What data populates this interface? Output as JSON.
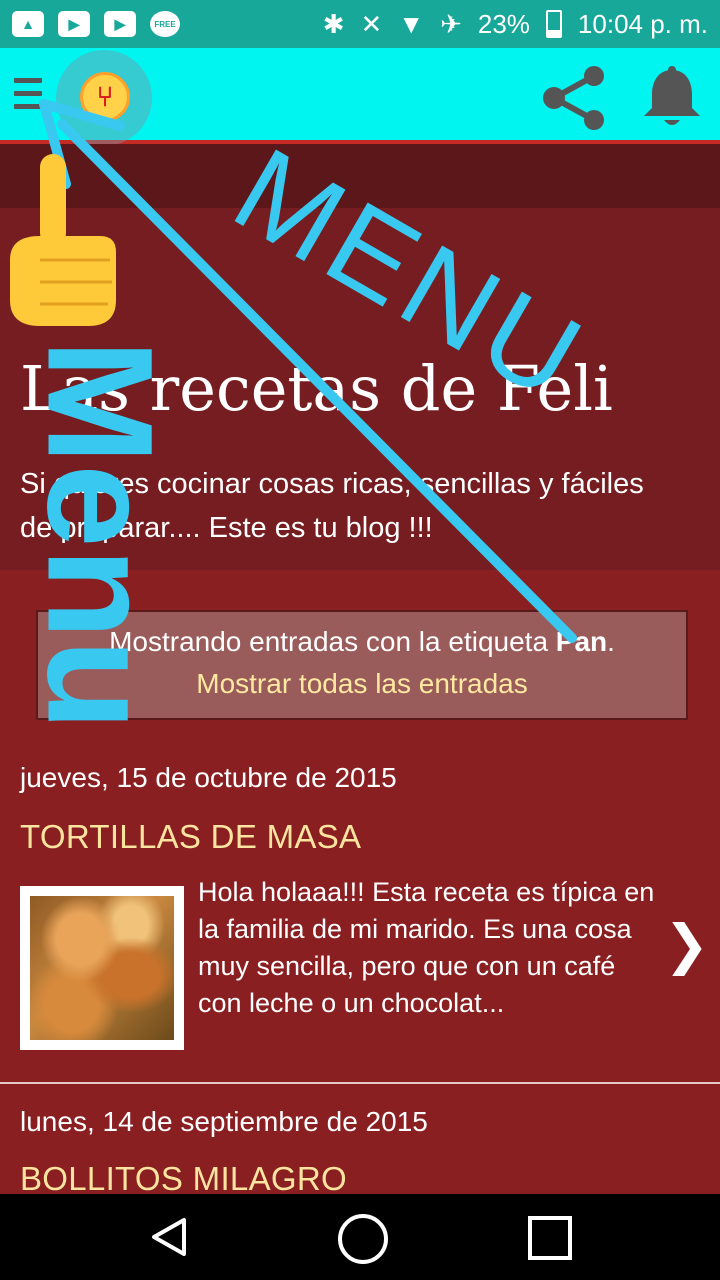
{
  "status_bar": {
    "battery": "23%",
    "time": "10:04 p. m.",
    "free_badge": "FREE"
  },
  "header": {
    "title": "Las recetas de Feli",
    "description": "Si quieres cocinar cosas ricas, sencillas y fáciles de preparar.... Este es tu blog !!!"
  },
  "filter": {
    "prefix": "Mostrando entradas con la etiqueta ",
    "label": "Pan",
    "suffix": ".",
    "show_all": "Mostrar todas las entradas"
  },
  "posts": [
    {
      "date": "jueves, 15 de octubre de 2015",
      "title": "TORTILLAS DE MASA",
      "snippet": "Hola holaaa!!! Esta receta es típica en la familia de mi marido. Es una cosa muy sencilla, pero que con un café con leche o un chocolat..."
    },
    {
      "date": "lunes, 14 de septiembre de 2015",
      "title": "BOLLITOS MILAGRO"
    }
  ],
  "annotations": {
    "menu_big": "MENU",
    "menu_vertical": "Menu"
  },
  "colors": {
    "status_bar": "#17a89a",
    "app_bar": "#00f5f1",
    "page_bg": "#8a1f22",
    "annotation": "#38c8f0",
    "post_title": "#fbe4a0"
  }
}
